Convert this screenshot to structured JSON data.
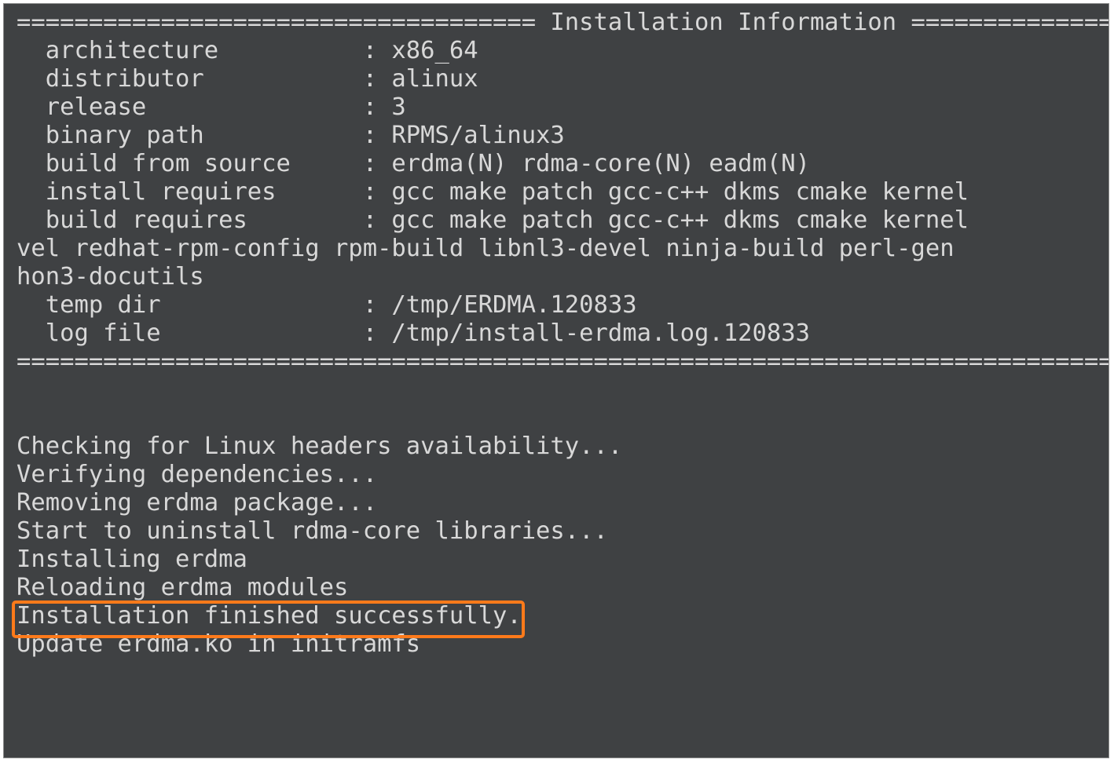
{
  "terminal": {
    "header_title": "Installation Information",
    "rows": [
      {
        "label": "architecture",
        "value": "x86_64"
      },
      {
        "label": "distributor",
        "value": "alinux"
      },
      {
        "label": "release",
        "value": "3"
      },
      {
        "label": "binary path",
        "value": "RPMS/alinux3"
      },
      {
        "label": "build from source",
        "value": "erdma(N) rdma-core(N) eadm(N)"
      },
      {
        "label": "install requires",
        "value": "gcc make patch gcc-c++ dkms cmake kernel"
      },
      {
        "label": "build requires",
        "value": "gcc make patch gcc-c++ dkms cmake kernel"
      }
    ],
    "wrapped_lines": [
      "vel redhat-rpm-config rpm-build libnl3-devel ninja-build perl-gen",
      "hon3-docutils"
    ],
    "rows2": [
      {
        "label": "temp dir",
        "value": "/tmp/ERDMA.120833"
      },
      {
        "label": "log file",
        "value": "/tmp/install-erdma.log.120833"
      }
    ],
    "divider_char": "=",
    "progress": [
      "Checking for Linux headers availability...",
      "Verifying dependencies...",
      "Removing erdma package...",
      "Start to uninstall rdma-core libraries...",
      "Installing erdma",
      "Reloading erdma modules",
      "Installation finished successfully.",
      "Update erdma.ko in initramfs"
    ],
    "highlight_index": 6
  }
}
